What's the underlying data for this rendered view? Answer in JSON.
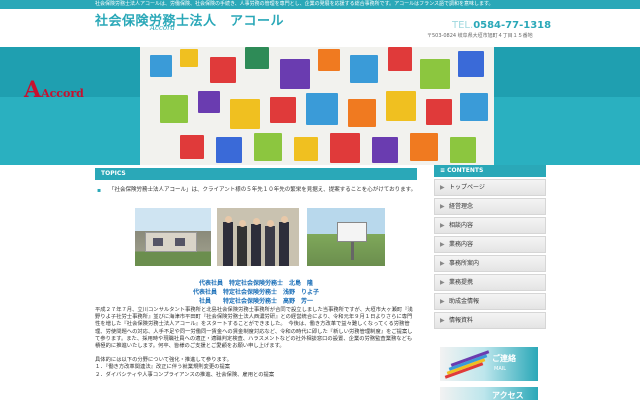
{
  "top_notice": "社会保険労務士法人アコールは、労働保険、社会保険の手続き、人事労務の管理を専門とし、企業の発展を応援する総合事務所です。アコールはフランス語で調和を意味します。",
  "header": {
    "title": "社会保険労務士法人　アコール",
    "subtitle": "Accord",
    "tel_label": "TEL.",
    "tel_number": "0584-77-1318",
    "address": "〒503-0824 岐阜県大垣市旭町４丁目１５番地"
  },
  "hero": {
    "logo_letter": "A",
    "logo_rest": "Accord"
  },
  "main": {
    "section_title": "TOPICS",
    "intro": "「社会保険労務士法人アコール」は、クライアント様の５年先１０年先の繁栄を見据え、提案することを心がけております。",
    "names": [
      "代表社員　特定社会保険労務士　北島　隆",
      "代表社員　特定社会保険労務士　浅野　りよ子",
      "社員　　特定社会保険労務士　高野　芳一"
    ],
    "paragraphs": [
      "平成２７年７月、立川コンサルタント事務所と北島社会保険労務士事務所が合同で設立しました当事務所ですが、大垣市大ヶ瀬町『浅野りよ子社労士事務所』並びに海津市平田町『社会保険労務士法人西濃労研』との経営統合により、令和元年９月１日よりさらに専門性を増した『社会保険労務士法人アコール』をスタートすることができました。　今後は、働き方改革で益々難しくなってくる労務管理、労使問題への対応、人手不足や同一労働同一賃金への賃金制度対応など、令和の時代に即した『新しい労務管理制度』をご提案して参ります。また、採用時や現職社員への適正・適職判定検査、ハラスメントなどの社外相談窓口の設置、企業の労務監査業務なども積極的に推進いたします。何卒、皆様のご支援とご愛顧をお願い申し上げます。",
      "具体的には以下の分野について強化・推進して参ります。"
    ],
    "list": [
      "１．『働き方改革関連法』改正に伴う就業規則変更の提案",
      "２．ダイバシティや人事コンプライアンスの推進、社会保険、雇用との提案"
    ]
  },
  "sidebar": {
    "section_title": "CONTENTS",
    "items": [
      "トップページ",
      "経営理念",
      "相談内容",
      "業務内容",
      "事務所案内",
      "業務提携",
      "助成金情報",
      "情報資料"
    ],
    "banner_contact_title": "ご連絡",
    "banner_contact_sub": "MAIL",
    "banner_access_title": "アクセス"
  },
  "colors": {
    "accent": "#2aa8b8",
    "logo_red": "#c8102e",
    "names_blue": "#1b6fb8"
  }
}
